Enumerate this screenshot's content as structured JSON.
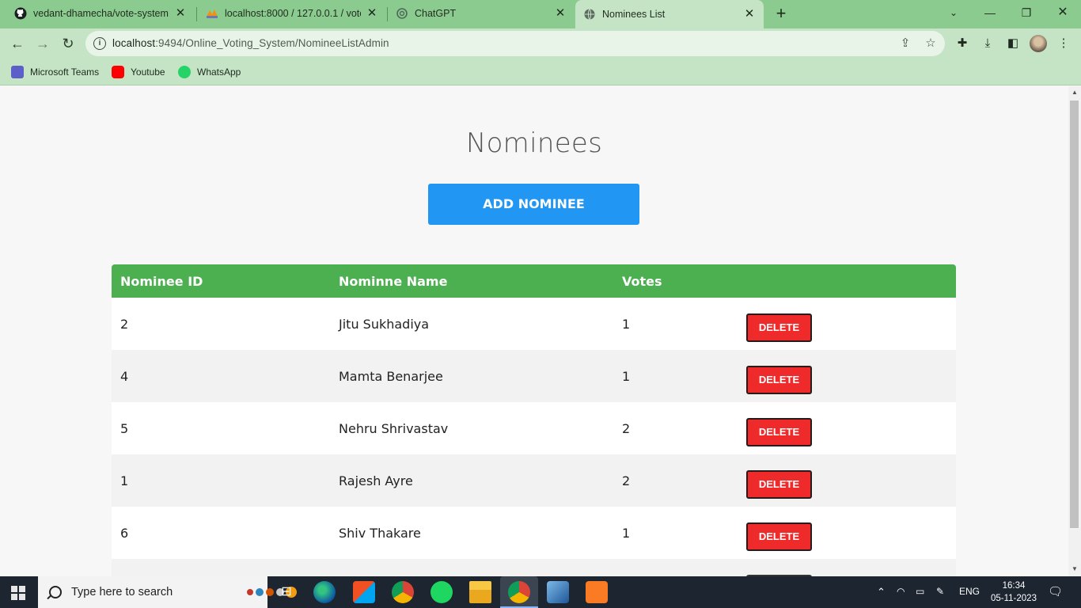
{
  "browser": {
    "tabs": [
      {
        "title": "vedant-dhamecha/vote-system",
        "icon": "github-icon"
      },
      {
        "title": "localhost:8000 / 127.0.0.1 / vote",
        "icon": "phpmyadmin-icon"
      },
      {
        "title": "ChatGPT",
        "icon": "chatgpt-icon"
      },
      {
        "title": "Nominees List",
        "icon": "globe-icon"
      }
    ],
    "address": {
      "host": "localhost",
      "path": ":9494/Online_Voting_System/NomineeListAdmin"
    },
    "bookmarks": [
      {
        "label": "Microsoft Teams",
        "icon": "teams-icon",
        "color": "#5b5fc7"
      },
      {
        "label": "Youtube",
        "icon": "youtube-icon",
        "color": "#ff0000"
      },
      {
        "label": "WhatsApp",
        "icon": "whatsapp-icon",
        "color": "#25d366"
      }
    ]
  },
  "page": {
    "title": "Nominees",
    "add_button": "ADD NOMINEE",
    "accent": "#2196f3",
    "table_header_color": "#4caf50",
    "delete_color": "#ee2a2a",
    "table": {
      "columns": [
        "Nominee ID",
        "Nominne Name",
        "Votes"
      ],
      "delete_label": "DELETE",
      "rows": [
        {
          "id": "2",
          "name": "Jitu Sukhadiya",
          "votes": "1"
        },
        {
          "id": "4",
          "name": "Mamta Benarjee",
          "votes": "1"
        },
        {
          "id": "5",
          "name": "Nehru Shrivastav",
          "votes": "2"
        },
        {
          "id": "1",
          "name": "Rajesh Ayre",
          "votes": "2"
        },
        {
          "id": "6",
          "name": "Shiv Thakare",
          "votes": "1"
        }
      ]
    }
  },
  "taskbar": {
    "search_placeholder": "Type here to search",
    "apps": [
      "task-view-icon",
      "edge-icon",
      "store-icon",
      "chrome-icon",
      "spotify-icon",
      "file-explorer-icon",
      "chrome-icon",
      "virtualbox-icon",
      "xampp-icon"
    ],
    "language": "ENG",
    "time": "16:34",
    "date": "05-11-2023"
  }
}
